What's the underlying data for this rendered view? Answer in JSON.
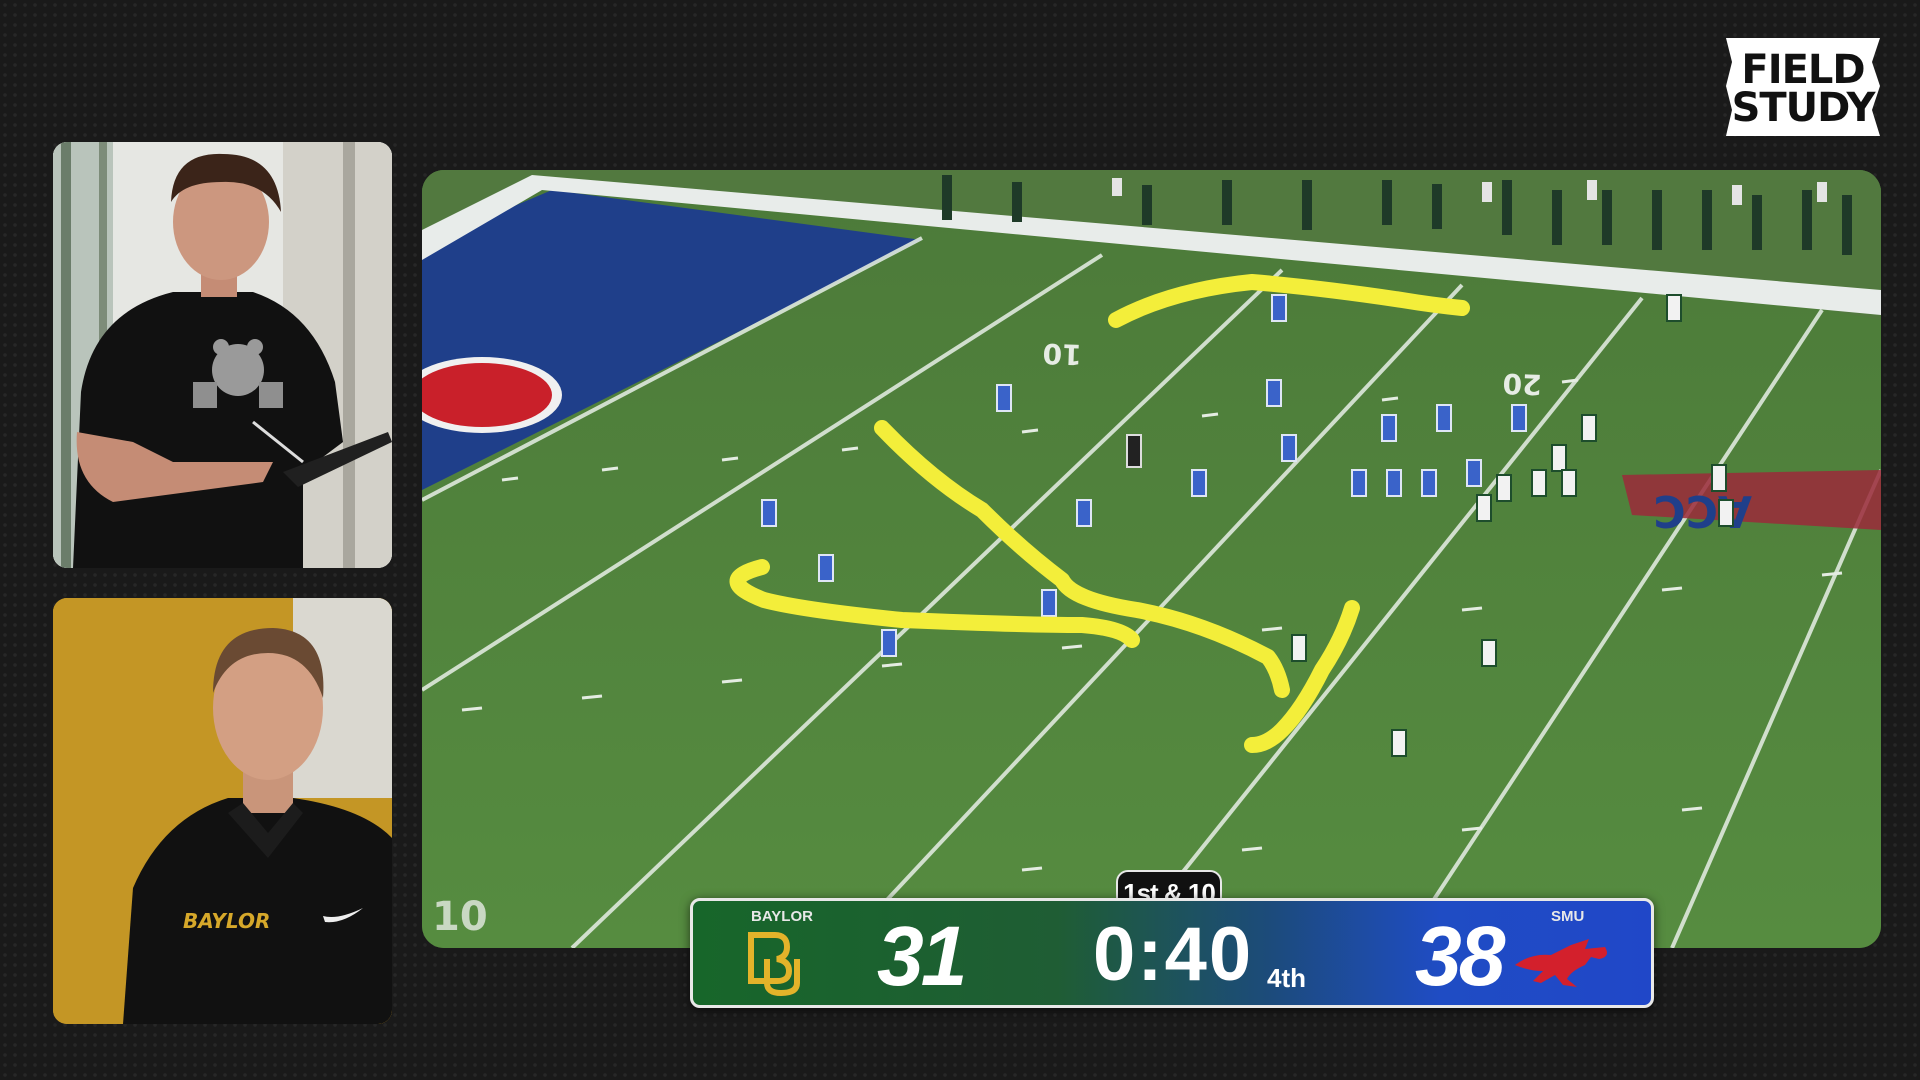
{
  "brand": {
    "line1": "FIELD",
    "line2": "STUDY"
  },
  "presenters": {
    "top": {
      "shirt_logo": "bear-mascot-icon"
    },
    "bottom": {
      "shirt_text": "BAYLOR"
    }
  },
  "field": {
    "yard_numbers": [
      "10",
      "20",
      "10"
    ],
    "endzone_letters": "ACC"
  },
  "scoreboard": {
    "down_distance": "1st & 10",
    "home": {
      "name": "BAYLOR",
      "score": "31",
      "color": "#17662a",
      "logo": "bu-logo-icon"
    },
    "away": {
      "name": "SMU",
      "score": "38",
      "color": "#2047c8",
      "logo": "mustang-logo-icon"
    },
    "clock": "0:40",
    "quarter": "4th"
  },
  "telestrator": {
    "color": "#f3ee3a"
  }
}
